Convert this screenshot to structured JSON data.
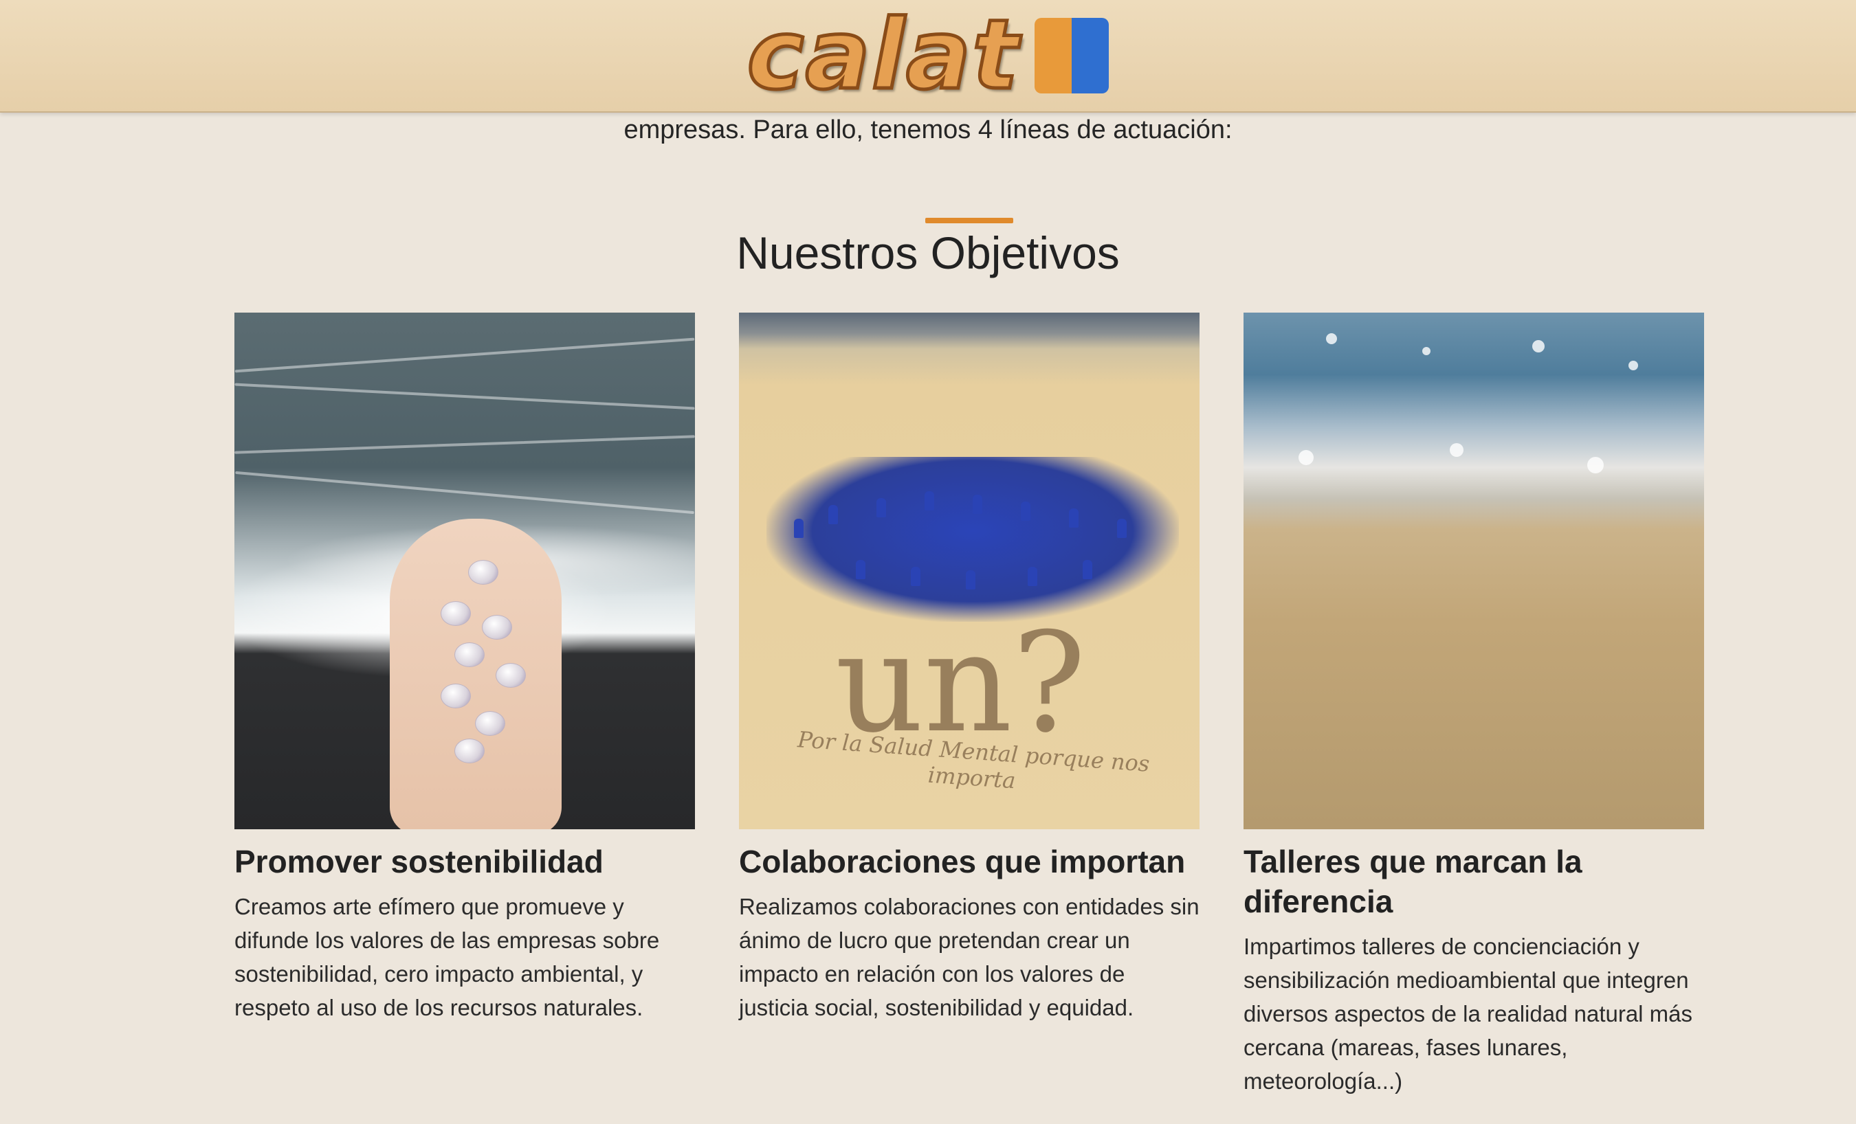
{
  "header": {
    "logo_text": "calat",
    "logo_colors": [
      "#e89a3a",
      "#2f6fd0"
    ]
  },
  "intro": {
    "text": "empresas. Para ello, tenemos 4 líneas de actuación:"
  },
  "section": {
    "title": "Nuestros Objetivos",
    "accent_color": "#e08a2c"
  },
  "cards": [
    {
      "image": "hand-holding-shells-on-beach",
      "title": "Promover sostenibilidad",
      "description": "Creamos arte efímero que promueve y difunde los valores de las empresas sobre sostenibilidad, cero impacto ambiental, y respeto al uso de los recursos naturales."
    },
    {
      "image": "group-photo-on-beach",
      "image_text_1": "un?",
      "image_text_2": "Por la Salud Mental porque nos importa",
      "title": "Colaboraciones que importan",
      "description": "Realizamos colaboraciones con entidades sin ánimo de lucro que pretendan crear un impacto en relación con los valores de justicia social, sostenibilidad y equidad."
    },
    {
      "image": "sand-and-sea-closeup",
      "title": "Talleres que marcan la diferencia",
      "description": "Impartimos talleres de concienciación y sensibilización medioambiental que integren diversos aspectos de la realidad natural más cercana (mareas, fases lunares, meteorología...)"
    }
  ]
}
